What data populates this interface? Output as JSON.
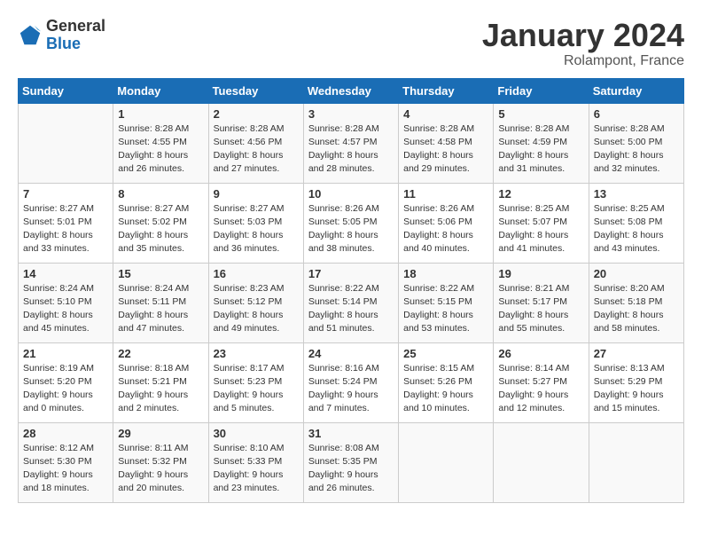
{
  "header": {
    "logo_general": "General",
    "logo_blue": "Blue",
    "month_title": "January 2024",
    "location": "Rolampont, France"
  },
  "columns": [
    "Sunday",
    "Monday",
    "Tuesday",
    "Wednesday",
    "Thursday",
    "Friday",
    "Saturday"
  ],
  "weeks": [
    [
      {
        "day": "",
        "sunrise": "",
        "sunset": "",
        "daylight": ""
      },
      {
        "day": "1",
        "sunrise": "Sunrise: 8:28 AM",
        "sunset": "Sunset: 4:55 PM",
        "daylight": "Daylight: 8 hours and 26 minutes."
      },
      {
        "day": "2",
        "sunrise": "Sunrise: 8:28 AM",
        "sunset": "Sunset: 4:56 PM",
        "daylight": "Daylight: 8 hours and 27 minutes."
      },
      {
        "day": "3",
        "sunrise": "Sunrise: 8:28 AM",
        "sunset": "Sunset: 4:57 PM",
        "daylight": "Daylight: 8 hours and 28 minutes."
      },
      {
        "day": "4",
        "sunrise": "Sunrise: 8:28 AM",
        "sunset": "Sunset: 4:58 PM",
        "daylight": "Daylight: 8 hours and 29 minutes."
      },
      {
        "day": "5",
        "sunrise": "Sunrise: 8:28 AM",
        "sunset": "Sunset: 4:59 PM",
        "daylight": "Daylight: 8 hours and 31 minutes."
      },
      {
        "day": "6",
        "sunrise": "Sunrise: 8:28 AM",
        "sunset": "Sunset: 5:00 PM",
        "daylight": "Daylight: 8 hours and 32 minutes."
      }
    ],
    [
      {
        "day": "7",
        "sunrise": "Sunrise: 8:27 AM",
        "sunset": "Sunset: 5:01 PM",
        "daylight": "Daylight: 8 hours and 33 minutes."
      },
      {
        "day": "8",
        "sunrise": "Sunrise: 8:27 AM",
        "sunset": "Sunset: 5:02 PM",
        "daylight": "Daylight: 8 hours and 35 minutes."
      },
      {
        "day": "9",
        "sunrise": "Sunrise: 8:27 AM",
        "sunset": "Sunset: 5:03 PM",
        "daylight": "Daylight: 8 hours and 36 minutes."
      },
      {
        "day": "10",
        "sunrise": "Sunrise: 8:26 AM",
        "sunset": "Sunset: 5:05 PM",
        "daylight": "Daylight: 8 hours and 38 minutes."
      },
      {
        "day": "11",
        "sunrise": "Sunrise: 8:26 AM",
        "sunset": "Sunset: 5:06 PM",
        "daylight": "Daylight: 8 hours and 40 minutes."
      },
      {
        "day": "12",
        "sunrise": "Sunrise: 8:25 AM",
        "sunset": "Sunset: 5:07 PM",
        "daylight": "Daylight: 8 hours and 41 minutes."
      },
      {
        "day": "13",
        "sunrise": "Sunrise: 8:25 AM",
        "sunset": "Sunset: 5:08 PM",
        "daylight": "Daylight: 8 hours and 43 minutes."
      }
    ],
    [
      {
        "day": "14",
        "sunrise": "Sunrise: 8:24 AM",
        "sunset": "Sunset: 5:10 PM",
        "daylight": "Daylight: 8 hours and 45 minutes."
      },
      {
        "day": "15",
        "sunrise": "Sunrise: 8:24 AM",
        "sunset": "Sunset: 5:11 PM",
        "daylight": "Daylight: 8 hours and 47 minutes."
      },
      {
        "day": "16",
        "sunrise": "Sunrise: 8:23 AM",
        "sunset": "Sunset: 5:12 PM",
        "daylight": "Daylight: 8 hours and 49 minutes."
      },
      {
        "day": "17",
        "sunrise": "Sunrise: 8:22 AM",
        "sunset": "Sunset: 5:14 PM",
        "daylight": "Daylight: 8 hours and 51 minutes."
      },
      {
        "day": "18",
        "sunrise": "Sunrise: 8:22 AM",
        "sunset": "Sunset: 5:15 PM",
        "daylight": "Daylight: 8 hours and 53 minutes."
      },
      {
        "day": "19",
        "sunrise": "Sunrise: 8:21 AM",
        "sunset": "Sunset: 5:17 PM",
        "daylight": "Daylight: 8 hours and 55 minutes."
      },
      {
        "day": "20",
        "sunrise": "Sunrise: 8:20 AM",
        "sunset": "Sunset: 5:18 PM",
        "daylight": "Daylight: 8 hours and 58 minutes."
      }
    ],
    [
      {
        "day": "21",
        "sunrise": "Sunrise: 8:19 AM",
        "sunset": "Sunset: 5:20 PM",
        "daylight": "Daylight: 9 hours and 0 minutes."
      },
      {
        "day": "22",
        "sunrise": "Sunrise: 8:18 AM",
        "sunset": "Sunset: 5:21 PM",
        "daylight": "Daylight: 9 hours and 2 minutes."
      },
      {
        "day": "23",
        "sunrise": "Sunrise: 8:17 AM",
        "sunset": "Sunset: 5:23 PM",
        "daylight": "Daylight: 9 hours and 5 minutes."
      },
      {
        "day": "24",
        "sunrise": "Sunrise: 8:16 AM",
        "sunset": "Sunset: 5:24 PM",
        "daylight": "Daylight: 9 hours and 7 minutes."
      },
      {
        "day": "25",
        "sunrise": "Sunrise: 8:15 AM",
        "sunset": "Sunset: 5:26 PM",
        "daylight": "Daylight: 9 hours and 10 minutes."
      },
      {
        "day": "26",
        "sunrise": "Sunrise: 8:14 AM",
        "sunset": "Sunset: 5:27 PM",
        "daylight": "Daylight: 9 hours and 12 minutes."
      },
      {
        "day": "27",
        "sunrise": "Sunrise: 8:13 AM",
        "sunset": "Sunset: 5:29 PM",
        "daylight": "Daylight: 9 hours and 15 minutes."
      }
    ],
    [
      {
        "day": "28",
        "sunrise": "Sunrise: 8:12 AM",
        "sunset": "Sunset: 5:30 PM",
        "daylight": "Daylight: 9 hours and 18 minutes."
      },
      {
        "day": "29",
        "sunrise": "Sunrise: 8:11 AM",
        "sunset": "Sunset: 5:32 PM",
        "daylight": "Daylight: 9 hours and 20 minutes."
      },
      {
        "day": "30",
        "sunrise": "Sunrise: 8:10 AM",
        "sunset": "Sunset: 5:33 PM",
        "daylight": "Daylight: 9 hours and 23 minutes."
      },
      {
        "day": "31",
        "sunrise": "Sunrise: 8:08 AM",
        "sunset": "Sunset: 5:35 PM",
        "daylight": "Daylight: 9 hours and 26 minutes."
      },
      {
        "day": "",
        "sunrise": "",
        "sunset": "",
        "daylight": ""
      },
      {
        "day": "",
        "sunrise": "",
        "sunset": "",
        "daylight": ""
      },
      {
        "day": "",
        "sunrise": "",
        "sunset": "",
        "daylight": ""
      }
    ]
  ]
}
